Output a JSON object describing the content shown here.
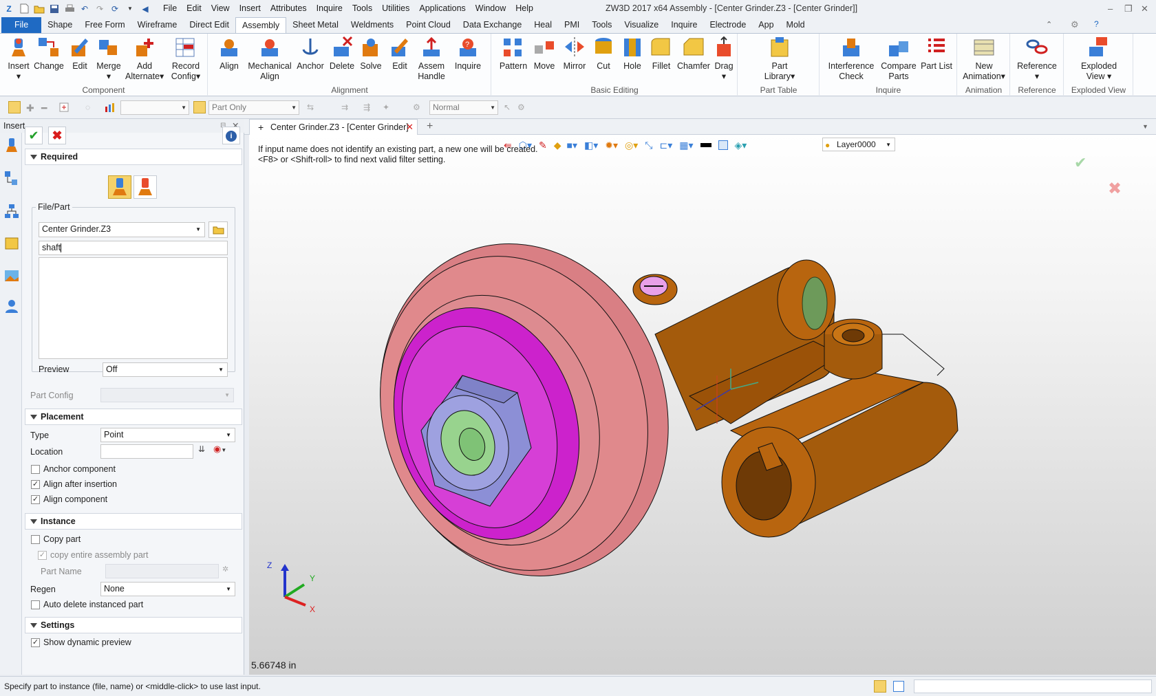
{
  "app": {
    "window_title": "ZW3D 2017 x64        Assembly - [Center Grinder.Z3 - [Center Grinder]]",
    "menu": [
      "File",
      "Edit",
      "View",
      "Insert",
      "Attributes",
      "Inquire",
      "Tools",
      "Utilities",
      "Applications",
      "Window",
      "Help"
    ]
  },
  "ribbon_tabs": [
    "File",
    "Shape",
    "Free Form",
    "Wireframe",
    "Direct Edit",
    "Assembly",
    "Sheet Metal",
    "Weldments",
    "Point Cloud",
    "Data Exchange",
    "Heal",
    "PMI",
    "Tools",
    "Visualize",
    "Inquire",
    "Electrode",
    "App",
    "Mold"
  ],
  "active_tab": "Assembly",
  "ribbon": {
    "component": {
      "label": "Component",
      "buttons": [
        "Insert",
        "Change",
        "Edit",
        "Merge",
        "Add Alternate",
        "Record Config"
      ]
    },
    "alignment": {
      "label": "Alignment",
      "buttons": [
        "Align",
        "Mechanical Align",
        "Anchor",
        "Delete",
        "Solve",
        "Edit",
        "Assem Handle",
        "Inquire"
      ]
    },
    "basic_editing": {
      "label": "Basic Editing",
      "buttons": [
        "Pattern",
        "Move",
        "Mirror",
        "Cut",
        "Hole",
        "Fillet",
        "Chamfer",
        "Drag"
      ]
    },
    "part_table": {
      "label": "Part Table",
      "buttons": [
        "Part Library"
      ]
    },
    "inquire": {
      "label": "Inquire",
      "buttons": [
        "Interference Check",
        "Compare Parts",
        "Part List"
      ]
    },
    "animation": {
      "label": "Animation",
      "buttons": [
        "New Animation"
      ]
    },
    "reference": {
      "label": "Reference",
      "buttons": [
        "Reference"
      ]
    },
    "exploded_view": {
      "label": "Exploded View",
      "buttons": [
        "Exploded View"
      ]
    }
  },
  "toolbar2": {
    "filter_value": "Part Only",
    "display_value": "Normal"
  },
  "panel": {
    "title": "Insert",
    "required_label": "Required",
    "file_part_label": "File/Part",
    "file_value": "Center Grinder.Z3",
    "name_value": "shaft",
    "preview_label": "Preview",
    "preview_value": "Off",
    "part_config_label": "Part Config",
    "placement_label": "Placement",
    "type_label": "Type",
    "type_value": "Point",
    "location_label": "Location",
    "anchor_component": "Anchor component",
    "align_after_insertion": "Align after insertion",
    "align_component": "Align component",
    "instance_label": "Instance",
    "copy_part": "Copy part",
    "copy_entire": "copy entire assembly part",
    "part_name_label": "Part  Name",
    "regen_label": "Regen",
    "regen_value": "None",
    "auto_delete": "Auto delete instanced part",
    "settings_label": "Settings",
    "show_dynamic_preview": "Show dynamic preview",
    "checks": {
      "anchor": false,
      "align_after": true,
      "align_comp": true,
      "copy_part": false,
      "copy_entire": true,
      "auto_delete": false,
      "dynamic_preview": true
    }
  },
  "document_tab": "Center Grinder.Z3 - [Center Grinder]",
  "viewport": {
    "hint_line1": "If input name does not identify an existing part, a new one will be created.",
    "hint_line2": "<F8> or <Shift-roll> to find next valid filter setting.",
    "layer": "Layer0000",
    "measurement": "5.66748 in",
    "axes": {
      "x": "X",
      "y": "Y",
      "z": "Z"
    }
  },
  "status_text": "Specify part to instance (file, name) or <middle-click> to use last input.",
  "colors": {
    "accent": "#1f6ac3",
    "wheel": "#e0898c",
    "magenta": "#cc22cc",
    "body": "#b8650f",
    "nut": "#8c8fd6",
    "bushing": "#98d38e"
  }
}
